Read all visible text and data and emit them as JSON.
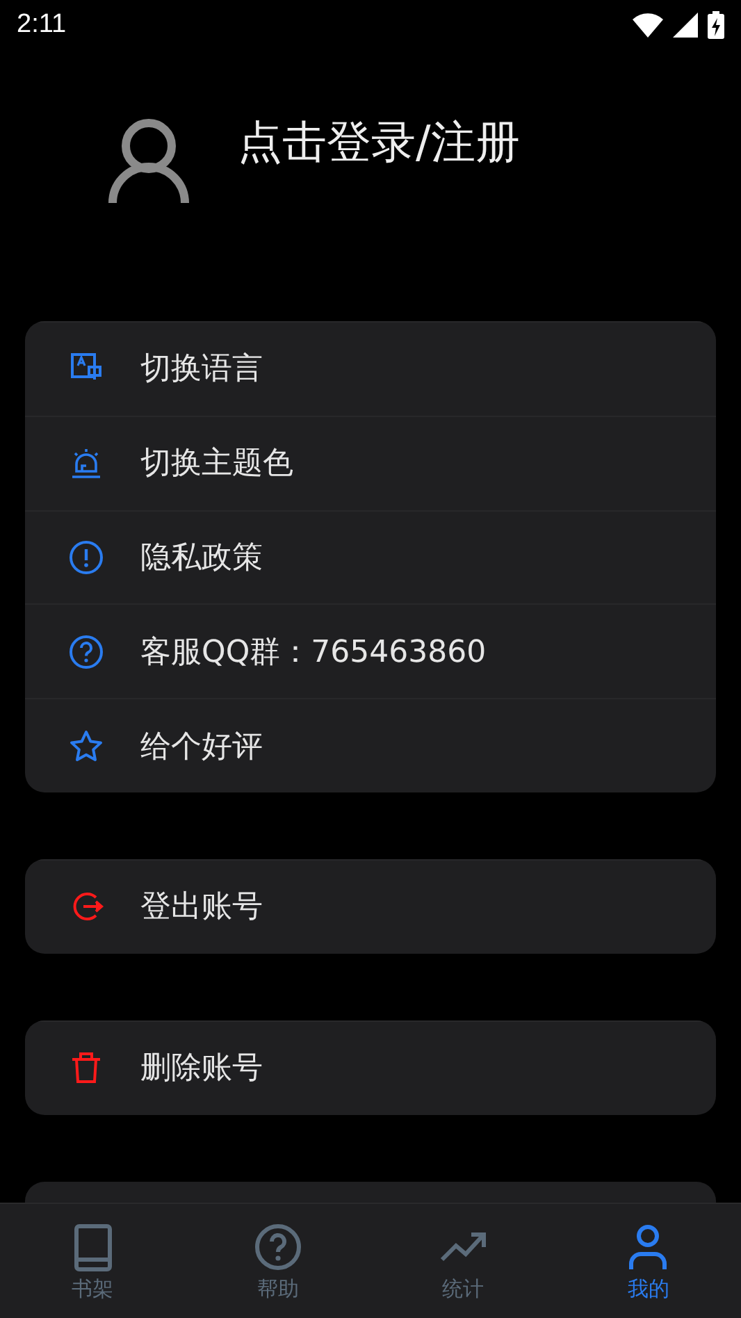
{
  "status_bar": {
    "time": "2:11"
  },
  "profile": {
    "login_text": "点击登录/注册"
  },
  "menu_groups": [
    {
      "items": [
        {
          "kind": "language",
          "label": "切换语言",
          "color": "#2a7cf0"
        },
        {
          "kind": "theme",
          "label": "切换主题色",
          "color": "#2a7cf0"
        },
        {
          "kind": "privacy",
          "label": "隐私政策",
          "color": "#2a7cf0"
        },
        {
          "kind": "support",
          "label": "客服QQ群：765463860",
          "color": "#2a7cf0"
        },
        {
          "kind": "rate",
          "label": "给个好评",
          "color": "#2a7cf0"
        }
      ]
    },
    {
      "items": [
        {
          "kind": "logout",
          "label": "登出账号",
          "color": "#ff1a1a"
        }
      ]
    },
    {
      "items": [
        {
          "kind": "delete",
          "label": "删除账号",
          "color": "#ff1a1a"
        }
      ]
    }
  ],
  "bottom_nav": [
    {
      "kind": "shelf",
      "label": "书架",
      "selected": false
    },
    {
      "kind": "help",
      "label": "帮助",
      "selected": false
    },
    {
      "kind": "stats",
      "label": "统计",
      "selected": false
    },
    {
      "kind": "mine",
      "label": "我的",
      "selected": true
    }
  ]
}
